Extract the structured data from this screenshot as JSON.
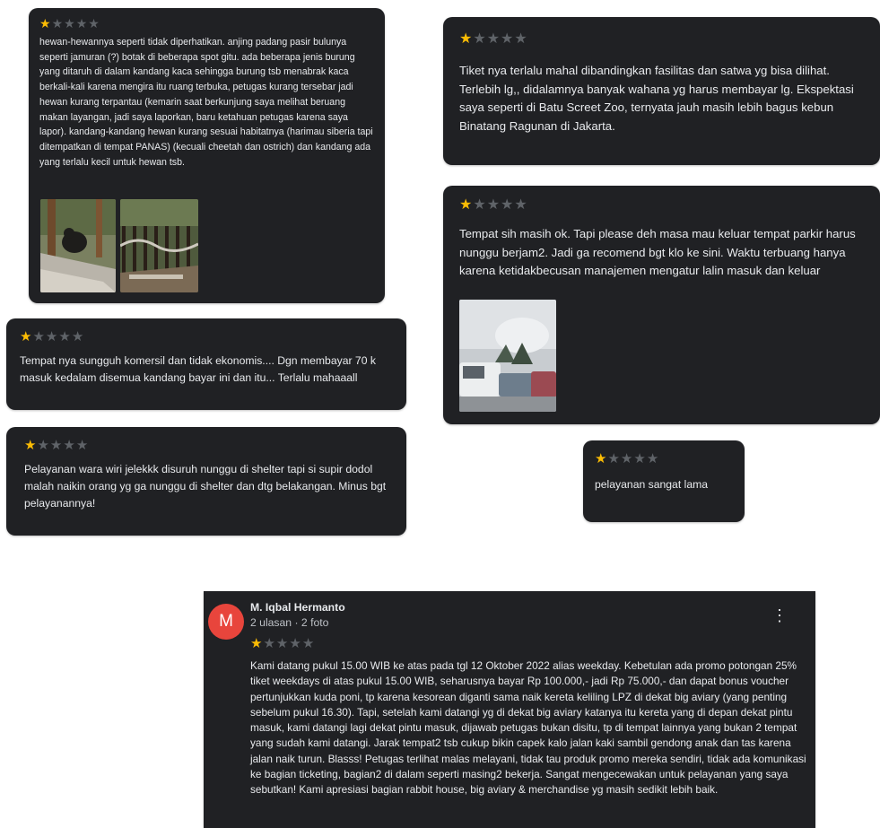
{
  "colors": {
    "card_background": "#202124",
    "card_text": "#e8eaed",
    "star_filled": "#fbbc04",
    "star_empty": "#5f6368",
    "avatar": "#e8453c"
  },
  "icons": {
    "star": "★",
    "more": "⋮"
  },
  "reviews": [
    {
      "rating": 1,
      "max_rating": 5,
      "text": "hewan-hewannya seperti tidak diperhatikan. anjing padang pasir bulunya seperti jamuran (?) botak di beberapa spot gitu. ada beberapa jenis burung yang ditaruh di dalam kandang kaca sehingga burung tsb menabrak kaca berkali-kali karena mengira itu ruang terbuka, petugas kurang tersebar jadi hewan kurang terpantau (kemarin saat berkunjung saya melihat beruang makan layangan, jadi saya laporkan, baru ketahuan petugas karena saya lapor). kandang-kandang hewan kurang sesuai habitatnya (harimau siberia tapi ditempatkan di tempat PANAS) (kecuali cheetah dan ostrich) dan kandang ada yang terlalu kecil untuk hewan tsb."
    },
    {
      "rating": 1,
      "max_rating": 5,
      "text": "Tempat nya sungguh komersil dan tidak ekonomis.... Dgn membayar 70 k masuk kedalam disemua kandang bayar ini dan itu... Terlalu mahaaall"
    },
    {
      "rating": 1,
      "max_rating": 5,
      "text": "Pelayanan wara wiri jelekkk disuruh nunggu di shelter tapi si supir dodol malah naikin orang yg ga nunggu di shelter dan dtg belakangan. Minus bgt pelayanannya!"
    },
    {
      "rating": 1,
      "max_rating": 5,
      "text": "Tiket nya terlalu mahal dibandingkan fasilitas dan satwa yg bisa dilihat. Terlebih lg,, didalamnya banyak wahana yg harus membayar lg. Ekspektasi saya seperti di Batu Screet Zoo, ternyata jauh masih lebih bagus kebun Binatang Ragunan di Jakarta."
    },
    {
      "rating": 1,
      "max_rating": 5,
      "text": "Tempat sih masih ok. Tapi please deh masa mau keluar tempat parkir harus nunggu berjam2. Jadi ga recomend bgt klo ke sini. Waktu terbuang hanya karena ketidakbecusan manajemen mengatur lalin masuk dan keluar"
    },
    {
      "rating": 1,
      "max_rating": 5,
      "text": "pelayanan sangat lama"
    },
    {
      "rating": 1,
      "max_rating": 5,
      "avatar_letter": "M",
      "author": "M. Iqbal Hermanto",
      "meta": "2 ulasan · 2 foto",
      "text": "Kami datang pukul 15.00 WIB ke atas pada tgl 12 Oktober 2022 alias weekday. Kebetulan ada promo potongan 25% tiket weekdays di atas pukul 15.00 WIB, seharusnya bayar Rp 100.000,- jadi Rp 75.000,- dan dapat bonus voucher pertunjukkan kuda poni, tp karena kesorean diganti sama naik kereta keliling LPZ di dekat big aviary (yang penting sebelum pukul 16.30). Tapi, setelah kami datangi yg di dekat big aviary katanya itu kereta yang di depan dekat pintu masuk, kami datangi lagi dekat pintu masuk, dijawab petugas bukan disitu, tp di tempat lainnya yang bukan 2 tempat yang sudah kami datangi. Jarak tempat2 tsb cukup bikin capek kalo jalan kaki sambil gendong anak dan tas karena jalan naik turun. Blasss! Petugas terlihat malas melayani, tidak tau produk promo mereka sendiri, tidak ada komunikasi ke bagian ticketing, bagian2 di dalam seperti masing2 bekerja. Sangat mengecewakan untuk pelayanan yang saya sebutkan! Kami apresiasi bagian rabbit house, big aviary & merchandise yg masih sedikit lebih baik."
    }
  ]
}
